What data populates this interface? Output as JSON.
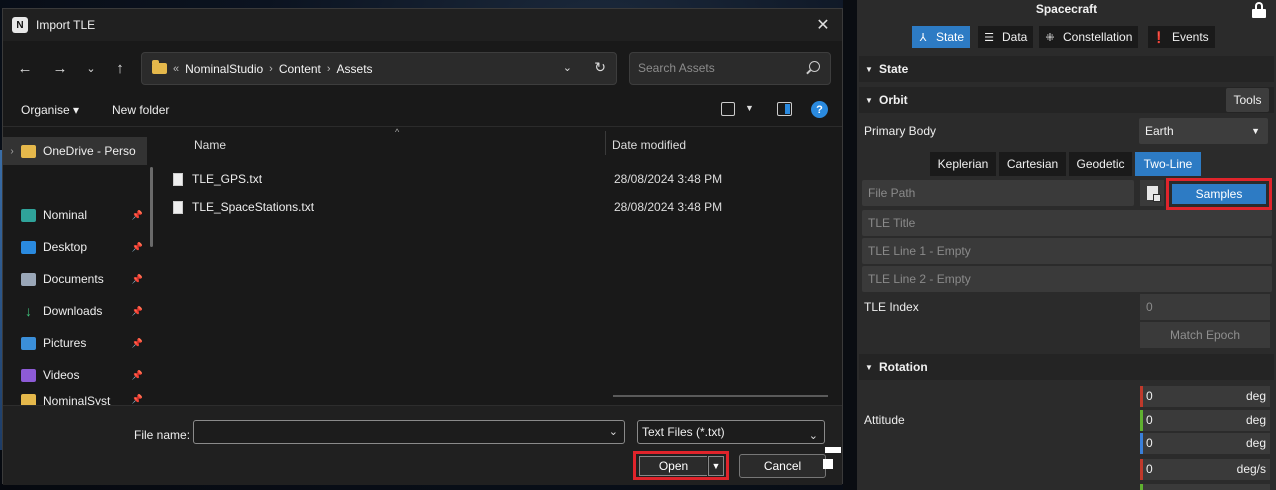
{
  "dialog": {
    "title": "Import TLE",
    "app_icon": "N",
    "close": "✕",
    "address": {
      "overflow": "«",
      "crumbs": [
        "NominalStudio",
        "Content",
        "Assets"
      ]
    },
    "search_placeholder": "Search Assets",
    "commands": {
      "organise": "Organise ▾",
      "new_folder": "New folder"
    },
    "sidebar": [
      {
        "label": "OneDrive - Perso",
        "icon": "folder-icon",
        "color": "#e5b84b",
        "expandable": true
      },
      {
        "label": "Nominal",
        "icon": "folder-icon",
        "color": "#2fa39a",
        "pinned": true
      },
      {
        "label": "Desktop",
        "icon": "desktop-icon",
        "color": "#2a8adf",
        "pinned": true
      },
      {
        "label": "Documents",
        "icon": "documents-icon",
        "color": "#9aa7b8",
        "pinned": true
      },
      {
        "label": "Downloads",
        "icon": "downloads-icon",
        "color": "#3fbf7a",
        "pinned": true
      },
      {
        "label": "Pictures",
        "icon": "pictures-icon",
        "color": "#3b8fd9",
        "pinned": true
      },
      {
        "label": "Videos",
        "icon": "videos-icon",
        "color": "#8d5bd6",
        "pinned": true
      },
      {
        "label": "NominalSyst",
        "icon": "folder-icon",
        "color": "#e5b84b",
        "pinned": true
      }
    ],
    "columns": {
      "name": "Name",
      "date": "Date modified"
    },
    "files": [
      {
        "name": "TLE_GPS.txt",
        "date": "28/08/2024 3:48 PM"
      },
      {
        "name": "TLE_SpaceStations.txt",
        "date": "28/08/2024 3:48 PM"
      }
    ],
    "footer": {
      "file_name_label": "File name:",
      "file_name_value": "",
      "file_type": "Text Files (*.txt)",
      "open": "Open",
      "cancel": "Cancel"
    }
  },
  "panel": {
    "title": "Spacecraft",
    "tabs": [
      {
        "label": "State",
        "icon": "state-icon",
        "active": true
      },
      {
        "label": "Data",
        "icon": "data-icon"
      },
      {
        "label": "Constellation",
        "icon": "constellation-icon"
      },
      {
        "label": "Events",
        "icon": "events-icon"
      }
    ],
    "state_section": "State",
    "orbit_section": "Orbit",
    "tools": "Tools",
    "primary_body_label": "Primary Body",
    "primary_body_value": "Earth",
    "orbit_tabs": [
      "Keplerian",
      "Cartesian",
      "Geodetic",
      "Two-Line"
    ],
    "orbit_tab_active": "Two-Line",
    "file_path_placeholder": "File Path",
    "samples": "Samples",
    "tle_title_placeholder": "TLE Title",
    "tle_line1_placeholder": "TLE Line 1 - Empty",
    "tle_line2_placeholder": "TLE Line 2 - Empty",
    "tle_index_label": "TLE Index",
    "tle_index_value": "0",
    "match_epoch": "Match Epoch",
    "rotation_section": "Rotation",
    "attitude_label": "Attitude",
    "attitude_values": [
      "0",
      "0",
      "0"
    ],
    "attitude_unit": "deg",
    "rate_value": "0",
    "rate_unit": "deg/s",
    "accent": "#2d7bc4",
    "highlight": "#e0242b"
  }
}
